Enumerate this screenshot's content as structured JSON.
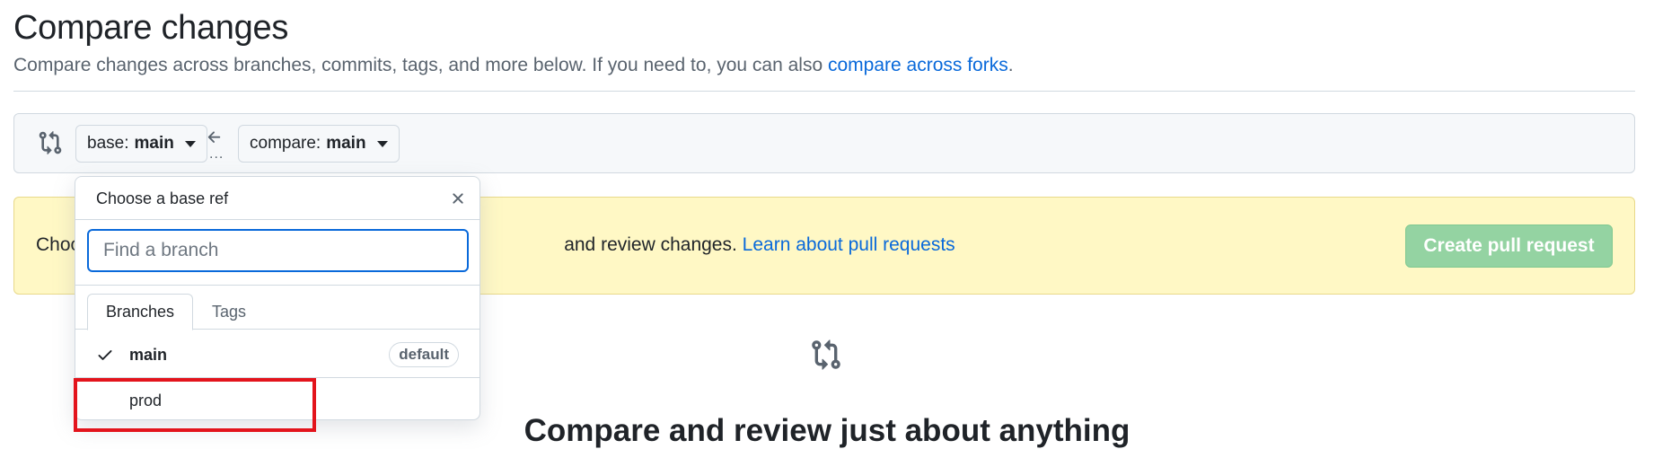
{
  "header": {
    "title": "Compare changes",
    "subtitle_text": "Compare changes across branches, commits, tags, and more below. If you need to, you can also ",
    "subtitle_link": "compare across forks",
    "subtitle_end": "."
  },
  "range": {
    "base_prefix": "base:",
    "base_branch": "main",
    "compare_prefix": "compare:",
    "compare_branch": "main",
    "ellipsis": "..."
  },
  "flash": {
    "text_start": "Choo",
    "text_end": "and review changes.",
    "link": "Learn about pull requests",
    "create_button": "Create pull request"
  },
  "blankslate": {
    "heading": "Compare and review just about anything"
  },
  "dropdown": {
    "title": "Choose a base ref",
    "filter_placeholder": "Find a branch",
    "tabs": [
      "Branches",
      "Tags"
    ],
    "items": [
      {
        "name": "main",
        "selected": true,
        "badge": "default"
      },
      {
        "name": "prod",
        "selected": false
      }
    ]
  },
  "colors": {
    "link": "#0969da",
    "flash_bg": "#fff8c5",
    "create_button_bg": "#94d3a2",
    "highlight": "#e3141c"
  }
}
